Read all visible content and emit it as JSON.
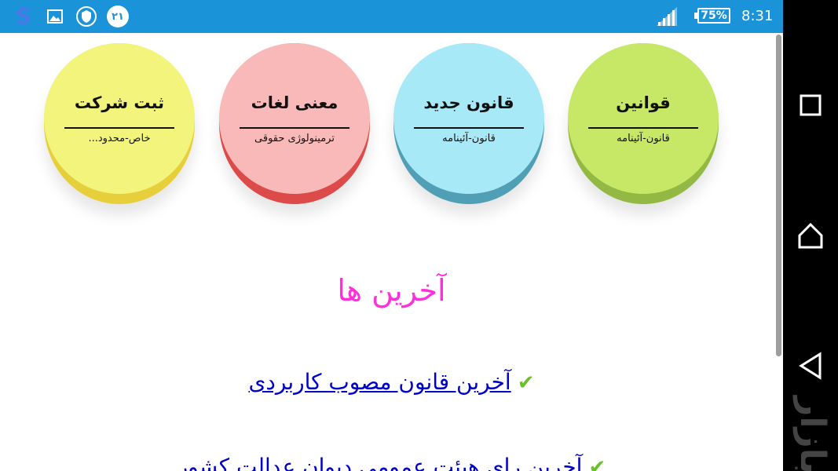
{
  "status_bar": {
    "app_letter": "S",
    "badge_text": "۲۱",
    "battery": "75%",
    "time": "8:31"
  },
  "circles": [
    {
      "title": "قوانین",
      "subtitle": "قانون-آئینامه"
    },
    {
      "title": "قانون جدید",
      "subtitle": "قانون-آئینامه"
    },
    {
      "title": "معنی لغات",
      "subtitle": "ترمینولوژی حقوقی"
    },
    {
      "title": "ثبت شرکت",
      "subtitle": "خاص-محدود..."
    }
  ],
  "latest": {
    "heading": "آخرین ها",
    "links": [
      {
        "text": "آخرین قانون مصوب کاربردی"
      },
      {
        "text": "آخرین رای هیئت عمومی دیوان عدالت کشور"
      }
    ]
  },
  "nav": {
    "watermark": "بازار"
  },
  "icons": {
    "gallery": "gallery-icon",
    "shield": "shield-icon",
    "signal": "signal-icon",
    "recent": "recent-apps-icon",
    "home": "home-icon",
    "back": "back-icon",
    "check": "check-icon"
  },
  "colors": {
    "status_bar": "#1a93d8",
    "heading": "#ff2fdc",
    "link": "#0000cc"
  }
}
